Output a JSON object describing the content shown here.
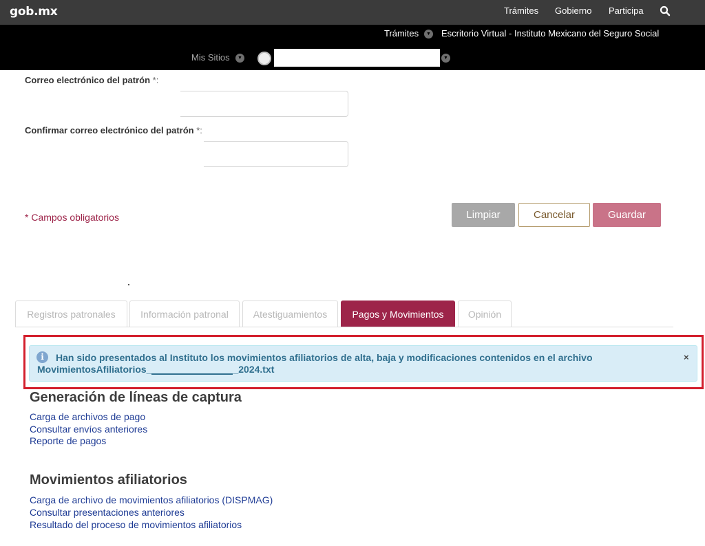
{
  "govbar": {
    "logo": "gob.mx",
    "nav": [
      "Trámites",
      "Gobierno",
      "Participa"
    ],
    "search_icon": "search-icon"
  },
  "subbar": {
    "tramites": "Trámites",
    "escritorio": "Escritorio Virtual - Instituto Mexicano del Seguro Social",
    "mis_sitios": "Mis Sitios"
  },
  "form": {
    "email_label": "Correo electrónico del patrón",
    "confirm_label": "Confirmar correo electrónico del patrón",
    "required_mark": "*:",
    "required_note": "* Campos obligatorios",
    "buttons": {
      "limpiar": "Limpiar",
      "cancelar": "Cancelar",
      "guardar": "Guardar"
    }
  },
  "tabs": [
    {
      "label": "Registros patronales",
      "active": false
    },
    {
      "label": "Información patronal",
      "active": false
    },
    {
      "label": "Atestiguamientos",
      "active": false
    },
    {
      "label": "Pagos y Movimientos",
      "active": true
    },
    {
      "label": "Opinión",
      "active": false
    }
  ],
  "alert": {
    "message": "Han sido presentados al Instituto los movimientos afiliatorios de alta, baja y modificaciones contenidos en el archivo",
    "file_prefix": "MovimientosAfiliatorios_",
    "file_suffix": "_2024.txt",
    "close": "×"
  },
  "captura": {
    "title": "Generación de líneas de captura",
    "links": [
      "Carga de archivos de pago",
      "Consultar envíos anteriores",
      "Reporte de pagos"
    ]
  },
  "movimientos": {
    "title": "Movimientos afiliatorios",
    "links": [
      "Carga de archivo de movimientos afiliatorios (DISPMAG)",
      "Consultar presentaciones anteriores",
      "Resultado del proceso de movimientos afiliatorios"
    ]
  },
  "colors": {
    "brand": "#9d2449",
    "alert_bg": "#d9edf7",
    "alert_text": "#31708f",
    "link": "#1f3c95",
    "highlight": "#d31f2d"
  }
}
